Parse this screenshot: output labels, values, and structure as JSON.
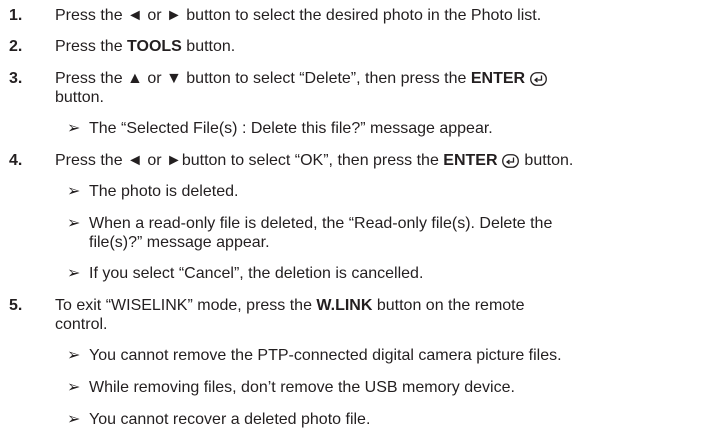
{
  "steps": [
    {
      "num": "1.",
      "parts": [
        "Press the ◄ or ► button to select the desired photo in the Photo list."
      ]
    },
    {
      "num": "2.",
      "a": "Press the ",
      "bold": "TOOLS",
      "b": " button."
    },
    {
      "num": "3.",
      "line1_a": "Press the ▲ or ▼ button to select “Delete”, then press the ",
      "line1_bold": "ENTER",
      "line2": "button."
    },
    {
      "num": "4.",
      "a": "Press the ◄ or ►button to select “OK”, then press the ",
      "bold": "ENTER",
      "b": " button."
    },
    {
      "num": "5.",
      "line1_a": "To exit “WISELINK” mode, press the ",
      "line1_bold": "W.LINK",
      "line1_b": " button on the remote",
      "line2": "control."
    }
  ],
  "notes": {
    "arrow": "➢",
    "step3": [
      "The “Selected File(s) : Delete this file?” message appear."
    ],
    "step4": [
      "The photo is deleted.",
      "When a read-only file is deleted, the “Read-only file(s). Delete the",
      "file(s)?” message appear.",
      "If you select “Cancel”, the deletion is cancelled."
    ],
    "step5": [
      "You cannot remove the PTP-connected digital camera picture files.",
      "While removing files, don’t remove the USB memory device.",
      "You cannot recover a deleted photo file."
    ]
  },
  "icons": {
    "enter": "enter-icon"
  }
}
